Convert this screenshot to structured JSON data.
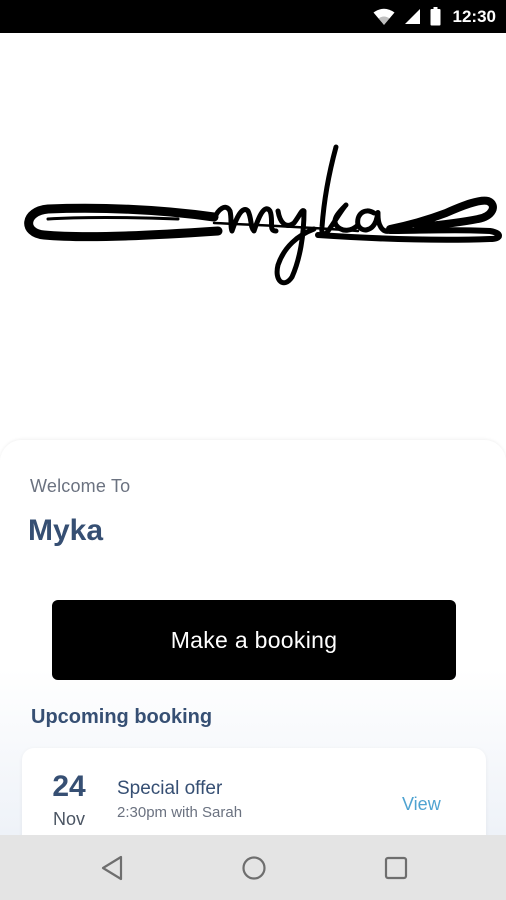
{
  "status_bar": {
    "time": "12:30",
    "icons": [
      "wifi-icon",
      "signal-icon",
      "battery-icon"
    ]
  },
  "logo": {
    "text": "myka"
  },
  "welcome": {
    "label": "Welcome To",
    "brand_name": "Myka"
  },
  "actions": {
    "booking_button_label": "Make a booking"
  },
  "upcoming": {
    "title": "Upcoming booking",
    "items": [
      {
        "day": "24",
        "month": "Nov",
        "title": "Special offer",
        "subtitle": "2:30pm with Sarah",
        "link": "View"
      }
    ]
  },
  "nav": {
    "buttons": [
      "back-icon",
      "home-icon",
      "recents-icon"
    ]
  },
  "colors": {
    "brand_text": "#364f73",
    "button_bg": "#000000",
    "link": "#4fa3d1",
    "status_bar": "#000000",
    "nav_bar": "#e4e4e4"
  }
}
